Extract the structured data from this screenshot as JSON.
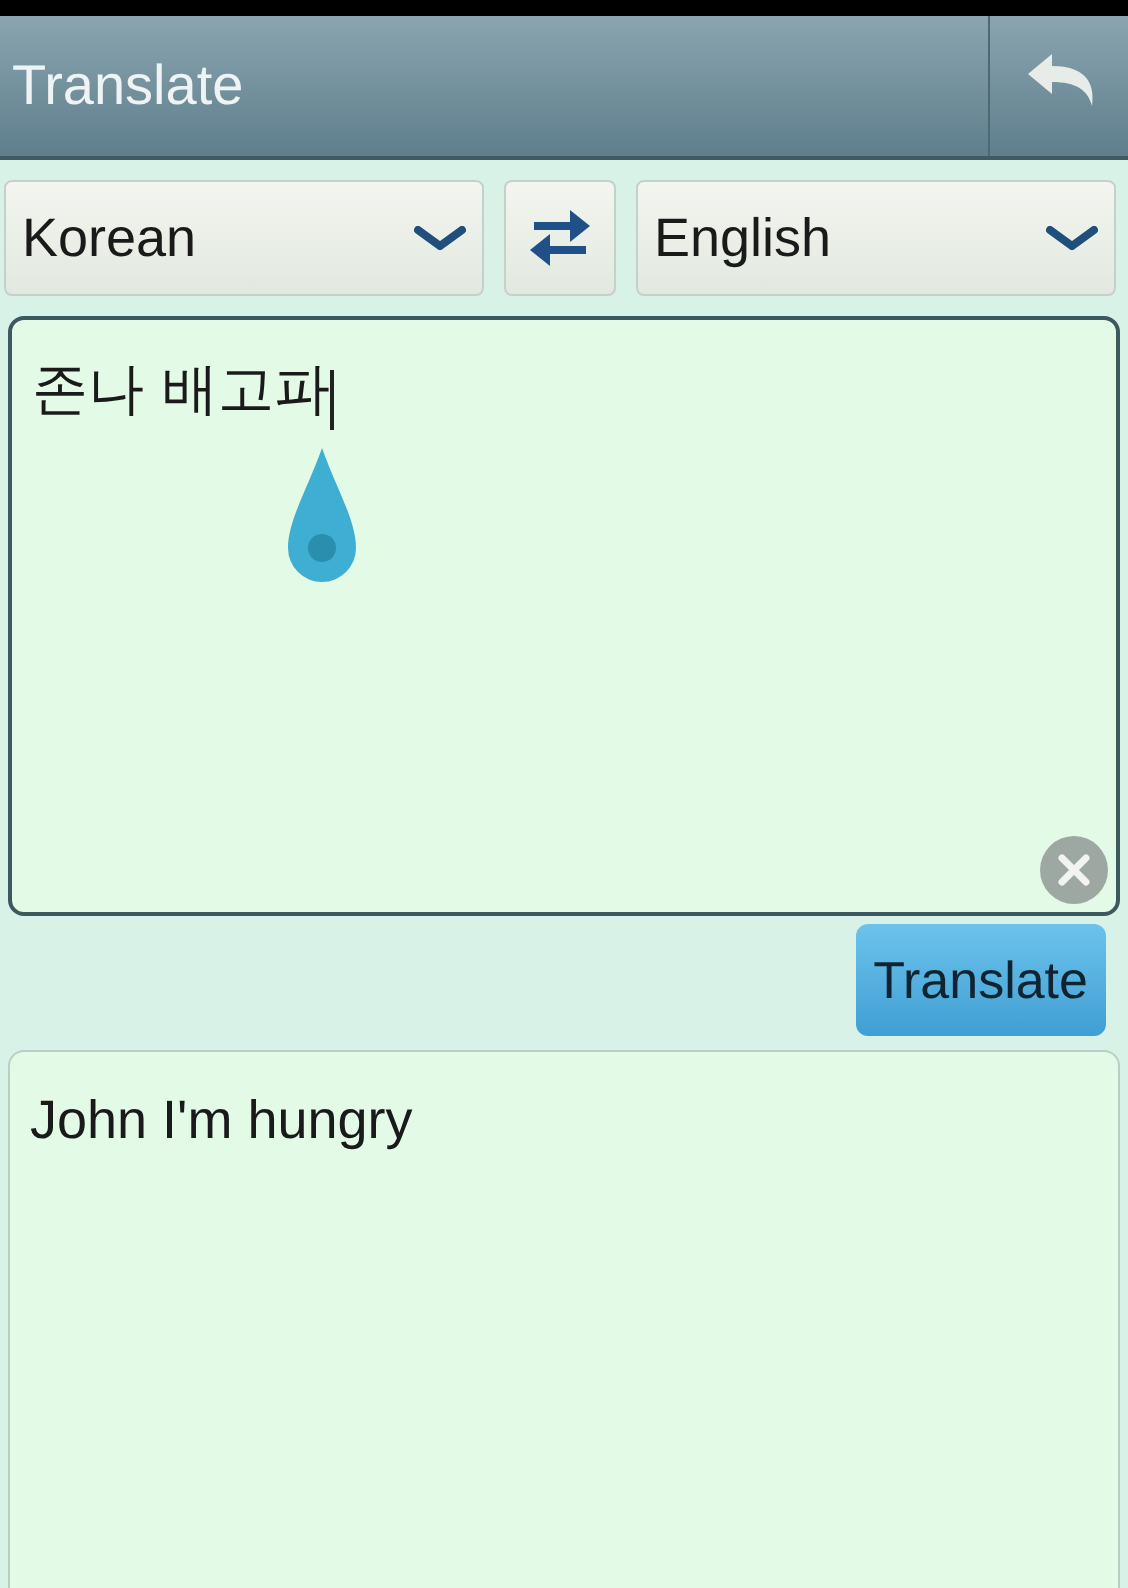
{
  "header": {
    "title": "Translate"
  },
  "languages": {
    "source": "Korean",
    "target": "English"
  },
  "input": {
    "value": "존나 배고파"
  },
  "translate_button": {
    "label": "Translate"
  },
  "output": {
    "text": "John I'm hungry"
  }
}
